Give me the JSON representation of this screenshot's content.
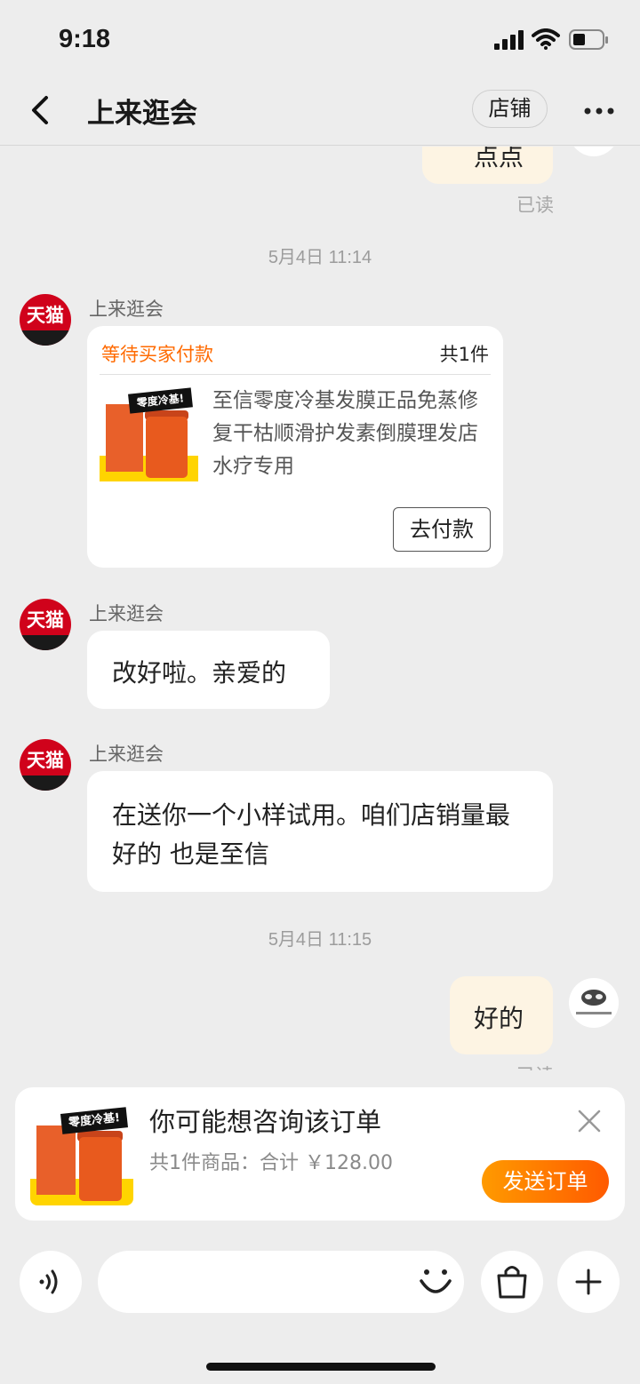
{
  "status_bar": {
    "time": "9:18"
  },
  "header": {
    "title": "上来逛会",
    "shop_button": "店铺"
  },
  "chat": {
    "partial_message": "点点",
    "read_receipt_1": "已读",
    "timestamp_1": "5月4日 11:14",
    "order_message": {
      "sender": "上来逛会",
      "avatar_text": "天猫",
      "status": "等待买家付款",
      "count": "共1件",
      "product_title": "至信零度冷基发膜正品免蒸修复干枯顺滑护发素倒膜理发店水疗专用",
      "product_badge": "零度冷基!",
      "pay_button": "去付款"
    },
    "message_2": {
      "sender": "上来逛会",
      "avatar_text": "天猫",
      "text": "改好啦。亲爱的"
    },
    "message_3": {
      "sender": "上来逛会",
      "avatar_text": "天猫",
      "text": "在送你一个小样试用。咱们店销量最好的 也是至信"
    },
    "timestamp_2": "5月4日 11:15",
    "my_message": {
      "text": "好的"
    },
    "read_receipt_2": "已读"
  },
  "consult_card": {
    "title": "你可能想咨询该订单",
    "summary": "共1件商品：合计 ￥128.00",
    "send_button": "发送订单",
    "product_badge": "零度冷基!"
  },
  "input_bar": {
    "placeholder": ""
  },
  "colors": {
    "accent": "#ff6a00",
    "tmall_red": "#d0021b",
    "my_bubble": "#fdf4e3"
  }
}
